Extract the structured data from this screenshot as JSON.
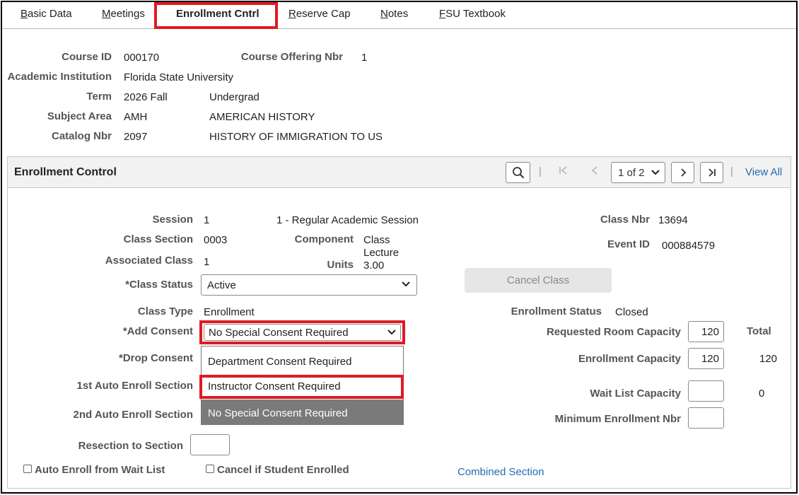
{
  "tabs": [
    {
      "label": "Basic Data",
      "ul": "B",
      "rest": "asic Data"
    },
    {
      "label": "Meetings",
      "ul": "M",
      "rest": "eetings"
    },
    {
      "label": "Enrollment Cntrl"
    },
    {
      "label": "Reserve Cap",
      "ul": "R",
      "rest": "eserve Cap"
    },
    {
      "label": "Notes",
      "ul": "N",
      "rest": "otes"
    },
    {
      "label": "FSU Textbook",
      "ul": "F",
      "rest": "SU Textbook"
    }
  ],
  "header": {
    "course_id_label": "Course ID",
    "course_id": "000170",
    "offering_label": "Course Offering Nbr",
    "offering": "1",
    "institution_label": "Academic Institution",
    "institution": "Florida State University",
    "term_label": "Term",
    "term": "2026 Fall",
    "career": "Undergrad",
    "subject_label": "Subject Area",
    "subject": "AMH",
    "subject_desc": "AMERICAN HISTORY",
    "catalog_label": "Catalog Nbr",
    "catalog": "2097",
    "catalog_desc": "HISTORY OF IMMIGRATION TO US"
  },
  "panel": {
    "title": "Enrollment Control",
    "page_select": "1 of 2",
    "view_all": "View All"
  },
  "form": {
    "session_label": "Session",
    "session": "1",
    "session_desc": "1 - Regular Academic Session",
    "section_label": "Class Section",
    "section": "0003",
    "component_label": "Component",
    "component_line1": "Class",
    "component_line2": "Lecture",
    "assoc_label": "Associated Class",
    "assoc": "1",
    "units_label": "Units",
    "units": "3.00",
    "class_nbr_label": "Class Nbr",
    "class_nbr": "13694",
    "event_label": "Event ID",
    "event": "000884579",
    "status_label": "*Class Status",
    "status": "Active",
    "cancel_class": "Cancel Class",
    "type_label": "Class Type",
    "type": "Enrollment",
    "enroll_status_label": "Enrollment Status",
    "enroll_status": "Closed",
    "add_consent_label": "*Add Consent",
    "add_consent": "No Special Consent Required",
    "drop_consent_label": "*Drop Consent",
    "auto1_label": "1st Auto Enroll Section",
    "auto2_label": "2nd Auto Enroll Section",
    "resection_label": "Resection to Section",
    "req_room_label": "Requested Room Capacity",
    "req_room": "120",
    "total_label": "Total",
    "enroll_cap_label": "Enrollment Capacity",
    "enroll_cap": "120",
    "enroll_total": "120",
    "waitlist_label": "Wait List Capacity",
    "waitlist_total": "0",
    "min_enroll_label": "Minimum Enrollment Nbr",
    "auto_enroll_wait": "Auto Enroll from Wait List",
    "cancel_if_enrolled": "Cancel if Student Enrolled",
    "combined_section": "Combined Section"
  },
  "dropdown_options": [
    "Department Consent Required",
    "Instructor Consent Required",
    "No Special Consent Required"
  ],
  "colors": {
    "highlight": "#e01a22",
    "link": "#1f6cb0",
    "selected_option": "#7a7a7a"
  }
}
